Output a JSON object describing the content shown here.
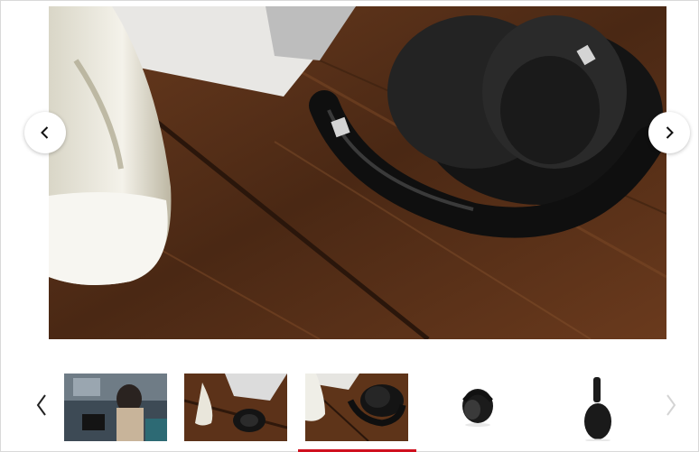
{
  "gallery": {
    "main_image": {
      "subject": "headphones-on-wooden-desk"
    },
    "nav": {
      "prev_icon": "chevron-left-icon",
      "next_icon": "chevron-right-icon"
    },
    "thumbnails": [
      {
        "subject": "person-wearing-headphones",
        "active": false
      },
      {
        "subject": "headphones-on-desk-with-laptop",
        "active": false
      },
      {
        "subject": "headphones-on-desk-closeup",
        "active": true
      },
      {
        "subject": "folded-black-headphones",
        "active": false
      },
      {
        "subject": "black-headphones-side-view",
        "active": false
      }
    ],
    "active_index": 3,
    "colors": {
      "accent": "#d0101f",
      "wood": "#5a3219",
      "headphones": "#1c1c1c"
    }
  }
}
